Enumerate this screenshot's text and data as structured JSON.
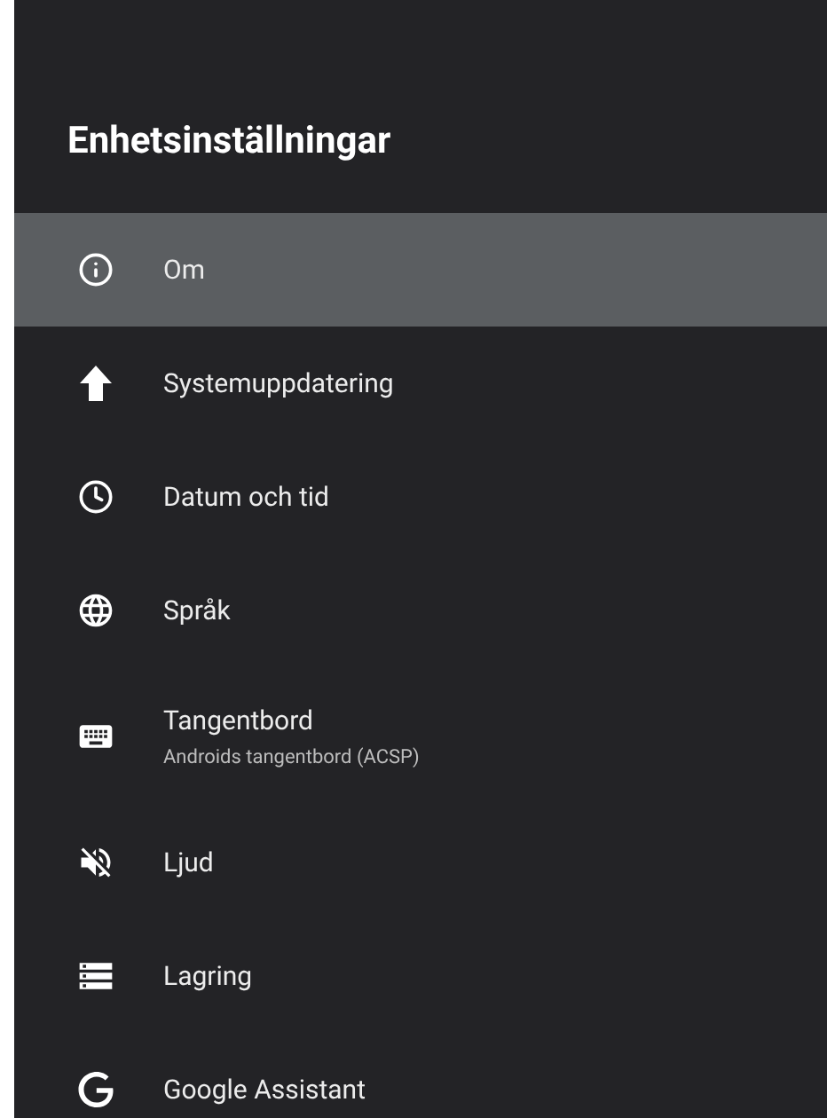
{
  "title": "Enhetsinställningar",
  "items": [
    {
      "label": "Om",
      "selected": true
    },
    {
      "label": "Systemuppdatering",
      "selected": false
    },
    {
      "label": "Datum och tid",
      "selected": false
    },
    {
      "label": "Språk",
      "selected": false
    },
    {
      "label": "Tangentbord",
      "subtitle": "Androids tangentbord (ACSP)",
      "selected": false
    },
    {
      "label": "Ljud",
      "selected": false
    },
    {
      "label": "Lagring",
      "selected": false
    },
    {
      "label": "Google Assistant",
      "selected": false
    }
  ]
}
